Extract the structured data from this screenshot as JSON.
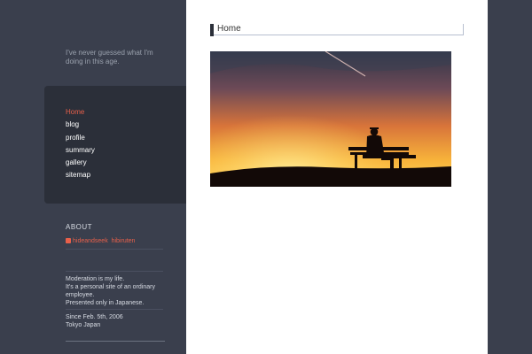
{
  "tagline": "I've never guessed what I'm doing in this age.",
  "nav": {
    "items": [
      {
        "label": "Home",
        "active": true
      },
      {
        "label": "blog",
        "active": false
      },
      {
        "label": "profile",
        "active": false
      },
      {
        "label": "summary",
        "active": false
      },
      {
        "label": "gallery",
        "active": false
      },
      {
        "label": "sitemap",
        "active": false
      }
    ]
  },
  "about": {
    "heading": "ABOUT",
    "link1": "hideandseek",
    "link2": "hibiruten",
    "desc": "Moderation is my life.\nIt's a personal site of an ordinary employee.\nPresented only in Japanese.",
    "since": "Since Feb. 5th, 2006\nTokyo Japan"
  },
  "main": {
    "title": "Home"
  },
  "colors": {
    "accent": "#e8604a",
    "sidebar": "#3a3f4d",
    "nav_panel": "#2b2f39"
  }
}
